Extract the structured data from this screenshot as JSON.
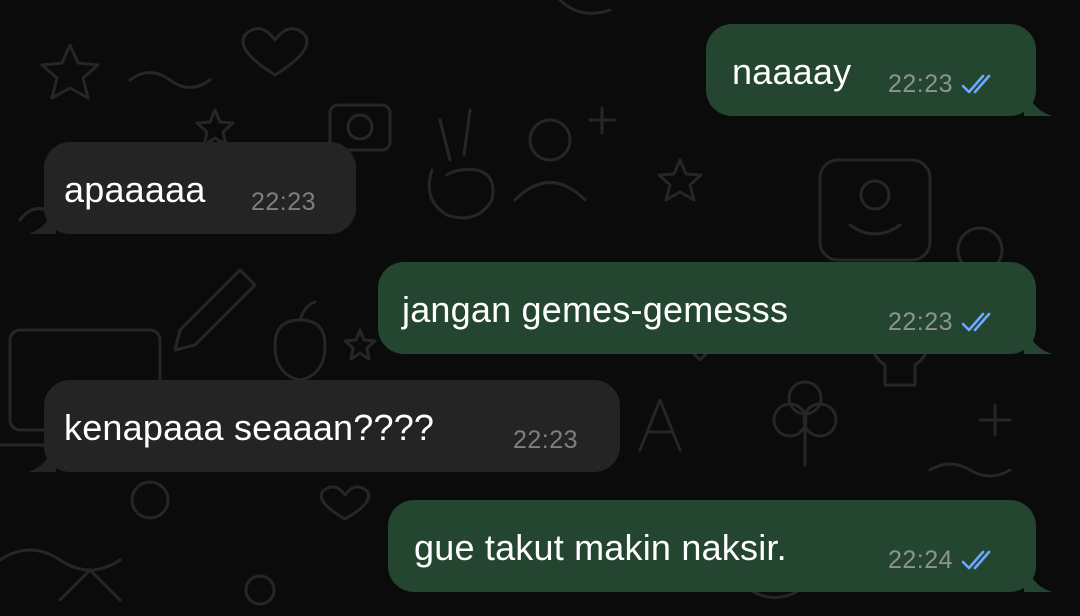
{
  "theme": {
    "background": "#0b0b0b",
    "incoming_bubble": "#242424",
    "outgoing_bubble": "#24452f",
    "text_color": "#ffffff",
    "time_color": "#8d948f",
    "read_tick_color": "#6ea8ff",
    "wallpaper_doodle_color": "#2a2a2a"
  },
  "messages": [
    {
      "direction": "outgoing",
      "text": "naaaay",
      "time": "22:23",
      "status": "read",
      "status_icon": "double-check-icon"
    },
    {
      "direction": "incoming",
      "text": "apaaaaa",
      "time": "22:23"
    },
    {
      "direction": "outgoing",
      "text": "jangan gemes-gemesss",
      "time": "22:23",
      "status": "read",
      "status_icon": "double-check-icon"
    },
    {
      "direction": "incoming",
      "text": "kenapaaa seaaan????",
      "time": "22:23"
    },
    {
      "direction": "outgoing",
      "text": "gue takut makin naksir.",
      "time": "22:24",
      "status": "read",
      "status_icon": "double-check-icon"
    }
  ]
}
